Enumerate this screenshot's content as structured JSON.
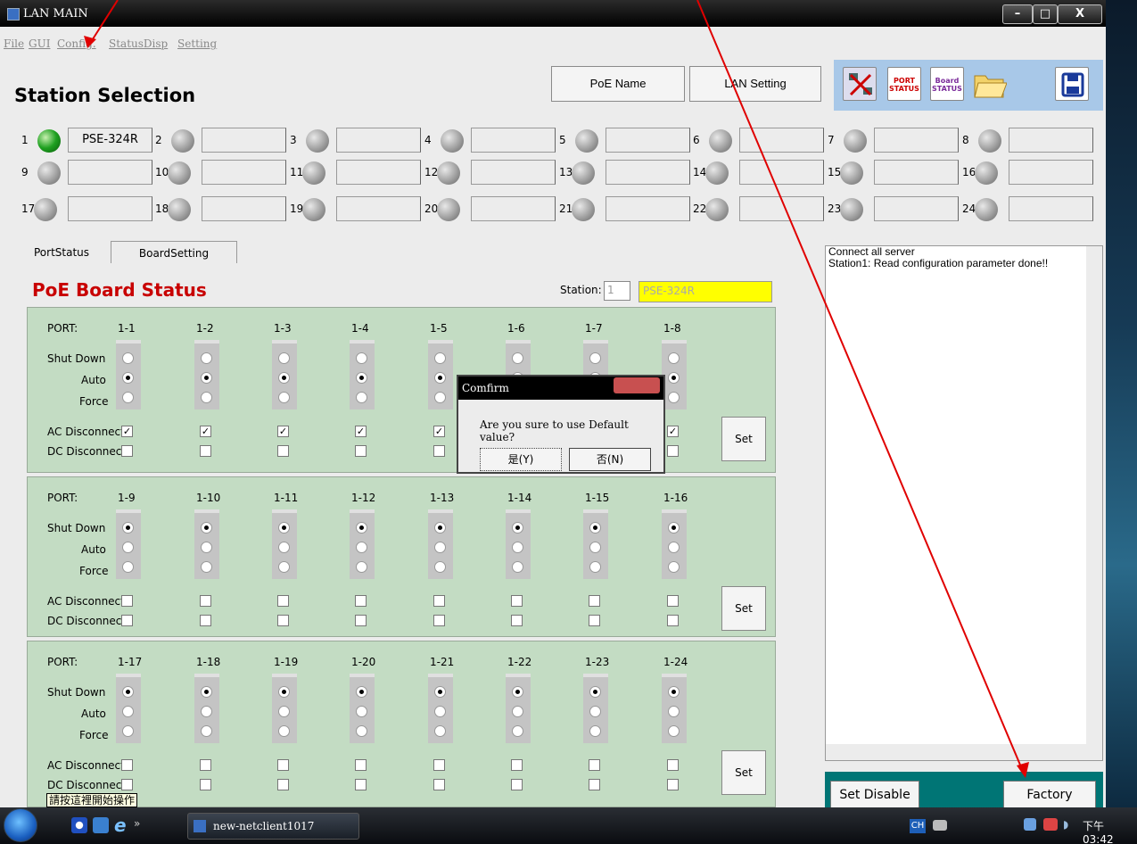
{
  "window": {
    "title": "LAN MAIN",
    "btn_min": "–",
    "btn_max": "□",
    "btn_close": "X"
  },
  "menu": [
    "File",
    "GUI",
    "Config.",
    "StatusDisp",
    "Setting"
  ],
  "header": {
    "title": "Station Selection",
    "poe_name": "PoE Name",
    "lan_setting": "LAN Setting",
    "icons": [
      "network-icon",
      "port-status-icon",
      "board-status-icon",
      "open-folder-icon",
      "save-disk-icon"
    ],
    "port_status_label": "PORT STATUS",
    "board_status_label": "Board STATUS"
  },
  "stations": [
    {
      "n": "1",
      "name": "PSE-324R",
      "on": true
    },
    {
      "n": "2",
      "name": ""
    },
    {
      "n": "3",
      "name": ""
    },
    {
      "n": "4",
      "name": ""
    },
    {
      "n": "5",
      "name": ""
    },
    {
      "n": "6",
      "name": ""
    },
    {
      "n": "7",
      "name": ""
    },
    {
      "n": "8",
      "name": ""
    },
    {
      "n": "9",
      "name": ""
    },
    {
      "n": "10",
      "name": ""
    },
    {
      "n": "11",
      "name": ""
    },
    {
      "n": "12",
      "name": ""
    },
    {
      "n": "13",
      "name": ""
    },
    {
      "n": "14",
      "name": ""
    },
    {
      "n": "15",
      "name": ""
    },
    {
      "n": "16",
      "name": ""
    },
    {
      "n": "17",
      "name": ""
    },
    {
      "n": "18",
      "name": ""
    },
    {
      "n": "19",
      "name": ""
    },
    {
      "n": "20",
      "name": ""
    },
    {
      "n": "21",
      "name": ""
    },
    {
      "n": "22",
      "name": ""
    },
    {
      "n": "23",
      "name": ""
    },
    {
      "n": "24",
      "name": ""
    }
  ],
  "tabs": [
    "PortStatus",
    "BoardSetting"
  ],
  "board": {
    "title": "PoE Board Status",
    "station_label": "Station:",
    "station_no": "1",
    "station_model": "PSE-324R",
    "labels": {
      "port": "PORT:",
      "shut": "Shut Down",
      "auto": "Auto",
      "force": "Force",
      "ac": "AC Disconnect",
      "dc": "DC Disconnect",
      "set": "Set"
    },
    "groups": [
      {
        "ports": [
          "1-1",
          "1-2",
          "1-3",
          "1-4",
          "1-5",
          "1-6",
          "1-7",
          "1-8"
        ],
        "mode": "auto",
        "ac": true,
        "dc": false
      },
      {
        "ports": [
          "1-9",
          "1-10",
          "1-11",
          "1-12",
          "1-13",
          "1-14",
          "1-15",
          "1-16"
        ],
        "mode": "shut",
        "ac": false,
        "dc": false
      },
      {
        "ports": [
          "1-17",
          "1-18",
          "1-19",
          "1-20",
          "1-21",
          "1-22",
          "1-23",
          "1-24"
        ],
        "mode": "shut",
        "ac": false,
        "dc": false
      }
    ]
  },
  "log": [
    "Connect all server",
    "Station1: Read configuration parameter done!!"
  ],
  "bottom": {
    "set_disable": "Set Disable",
    "factory": "Factory"
  },
  "dialog": {
    "title": "Comfirm",
    "message": "Are you sure to use Default value?",
    "yes": "是(Y)",
    "no": "否(N)"
  },
  "tooltip": "請按這裡開始操作",
  "taskbar": {
    "app": "new-netclient1017",
    "lang": "CH",
    "clock": "下午 03:42"
  }
}
